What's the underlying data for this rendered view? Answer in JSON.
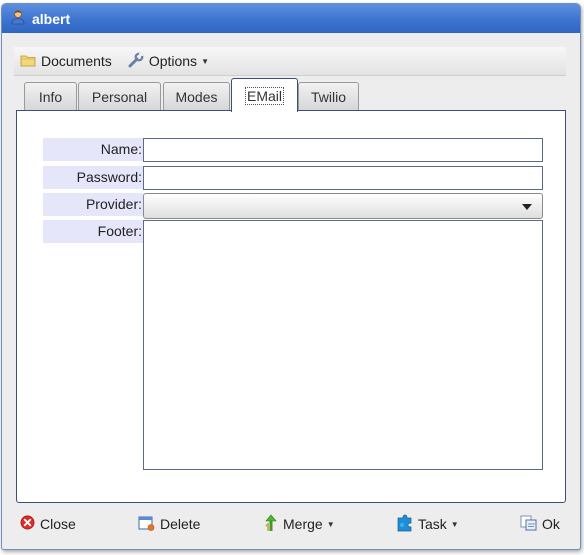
{
  "window": {
    "title": "albert"
  },
  "toolbar": {
    "documents_label": "Documents",
    "options_label": "Options"
  },
  "tabs": [
    {
      "label": "Info",
      "active": false
    },
    {
      "label": "Personal",
      "active": false
    },
    {
      "label": "Modes",
      "active": false
    },
    {
      "label": "EMail",
      "active": true
    },
    {
      "label": "Twilio",
      "active": false
    }
  ],
  "form": {
    "name_label": "Name:",
    "name_value": "",
    "password_label": "Password:",
    "password_value": "",
    "provider_label": "Provider:",
    "provider_value": "",
    "footer_label": "Footer:",
    "footer_value": ""
  },
  "bottombar": {
    "close_label": "Close",
    "delete_label": "Delete",
    "merge_label": "Merge",
    "task_label": "Task",
    "ok_label": "Ok"
  },
  "icons": {
    "title": "user-icon",
    "documents": "folder-icon",
    "options": "wrench-icon",
    "close": "close-circle-icon",
    "delete": "delete-window-icon",
    "merge": "merge-arrows-icon",
    "task": "puzzle-icon",
    "ok": "ok-copy-icon"
  },
  "colors": {
    "titlebar": "#3d74cf",
    "label_bg": "#e6e6fa",
    "panel_border": "#3a5078"
  }
}
